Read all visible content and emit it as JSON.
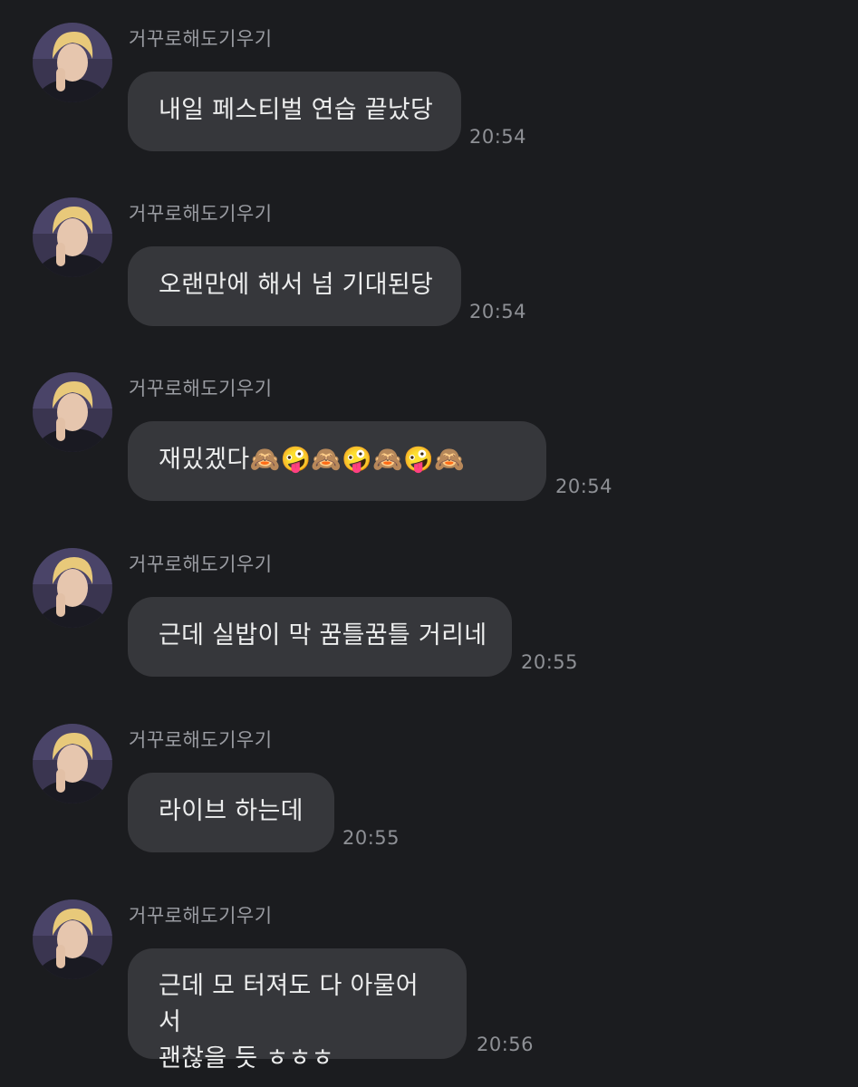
{
  "messages": [
    {
      "sender": "거꾸로해도기우기",
      "text": "내일 페스티벌 연습 끝났당",
      "time": "20:54"
    },
    {
      "sender": "거꾸로해도기우기",
      "text": "오랜만에 해서 넘 기대된당",
      "time": "20:54"
    },
    {
      "sender": "거꾸로해도기우기",
      "text": "재밌겠다🙈🤪🙈🤪🙈🤪🙈",
      "time": "20:54"
    },
    {
      "sender": "거꾸로해도기우기",
      "text": "근데 실밥이 막 꿈틀꿈틀 거리네",
      "time": "20:55"
    },
    {
      "sender": "거꾸로해도기우기",
      "text": "라이브 하는데",
      "time": "20:55"
    },
    {
      "sender": "거꾸로해도기우기",
      "text": "근데 모 터져도 다 아물어서\n괜찮을 듯 ㅎㅎㅎ",
      "time": "20:56"
    }
  ]
}
